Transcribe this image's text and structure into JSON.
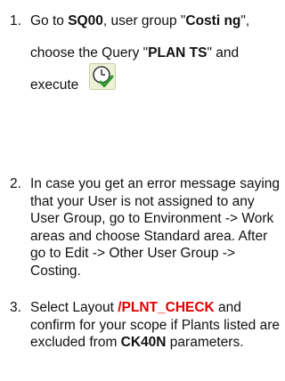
{
  "steps": [
    {
      "number": "1.",
      "parts": {
        "a": "Go to ",
        "b": "SQ00",
        "c": ", user group \"",
        "d": "Costi ng",
        "e": "\", choose the Query \"",
        "f": "PLAN TS",
        "g": "\" and execute"
      },
      "icon": "execute-query-clock-check-icon"
    },
    {
      "number": "2.",
      "text": "In case you get an error message saying that your User is not assigned to any User Group, go to Environment -> Work areas and choose Standard area. After go to Edit -> Other User Group -> Costing."
    },
    {
      "number": "3.",
      "parts": {
        "a": "Select Layout ",
        "b": "/PLNT_CHECK",
        "c": " and confirm for your scope if Plants listed are excluded from ",
        "d": "CK40N",
        "e": " parameters."
      }
    }
  ],
  "colors": {
    "text": "#111111",
    "highlight_red": "#e00000",
    "icon_green": "#2a9a2a",
    "icon_bg": "#eef1d6"
  }
}
